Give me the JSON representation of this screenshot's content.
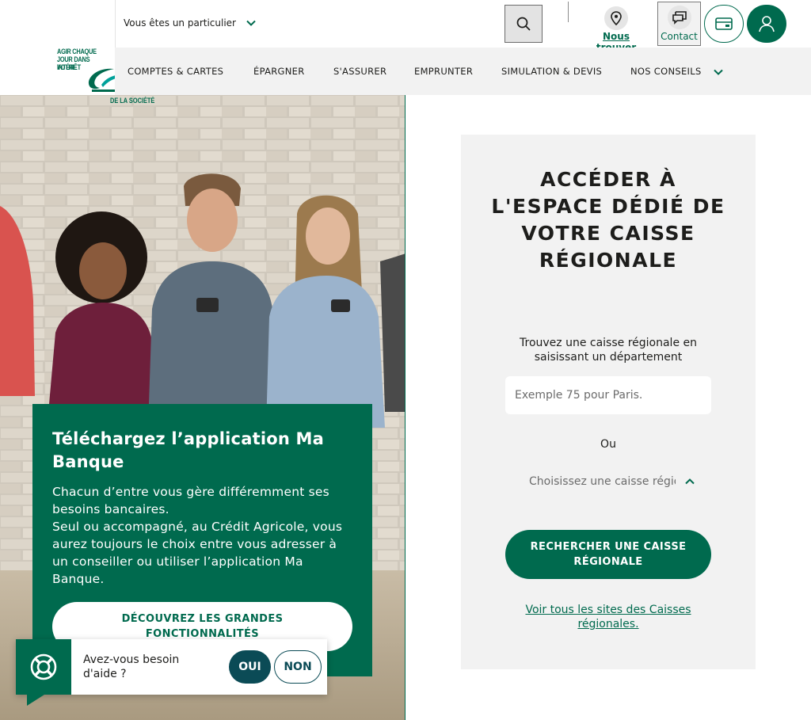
{
  "header": {
    "logo_text": [
      "AGIR CHAQUE",
      "JOUR DANS VOTRE",
      "INTÉRÊT"
    ],
    "logo_subtext": "DE LA SOCIÉTÉ",
    "profile_selector": "Vous êtes un particulier",
    "find_label": "Nous trouver",
    "contact_label": "Contact"
  },
  "nav": {
    "items": [
      "COMPTES & CARTES",
      "ÉPARGNER",
      "S'ASSURER",
      "EMPRUNTER",
      "SIMULATION & DEVIS",
      "NOS CONSEILS"
    ]
  },
  "promo": {
    "title": "Téléchargez l’application Ma Banque",
    "paragraph1": "Chacun d’entre vous gère différemment ses besoins bancaires.",
    "paragraph2": "Seul ou accompagné, au Crédit Agricole, vous aurez toujours le choix entre vous adresser à un conseiller ou utiliser l’application Ma Banque.",
    "button_label": "DÉCOUVREZ LES GRANDES FONCTIONNALITÉS"
  },
  "help": {
    "question": "Avez-vous besoin d'aide ?",
    "yes_label": "OUI",
    "no_label": "NON"
  },
  "regional": {
    "title": "ACCÉDER À L'ESPACE DÉDIÉ DE VOTRE CAISSE RÉGIONALE",
    "hint": "Trouvez une caisse régionale en saisissant un département",
    "input_placeholder": "Exemple 75 pour Paris.",
    "or_label": "Ou",
    "select_placeholder": "Choisissez une caisse régionale",
    "search_button": "RECHERCHER UNE CAISSE RÉGIONALE",
    "all_sites_link": "Voir tous les sites des Caisses régionales."
  },
  "colors": {
    "brand_green": "#006a4e",
    "help_dark": "#0b4b56",
    "panel_bg": "#f2f2f2",
    "nav_bg": "#f2f2f2"
  },
  "icons": [
    "chevron-down-icon",
    "search-icon",
    "location-pin-icon",
    "chat-bubble-icon",
    "card-icon",
    "user-icon",
    "lifebuoy-icon",
    "chevron-up-icon"
  ]
}
